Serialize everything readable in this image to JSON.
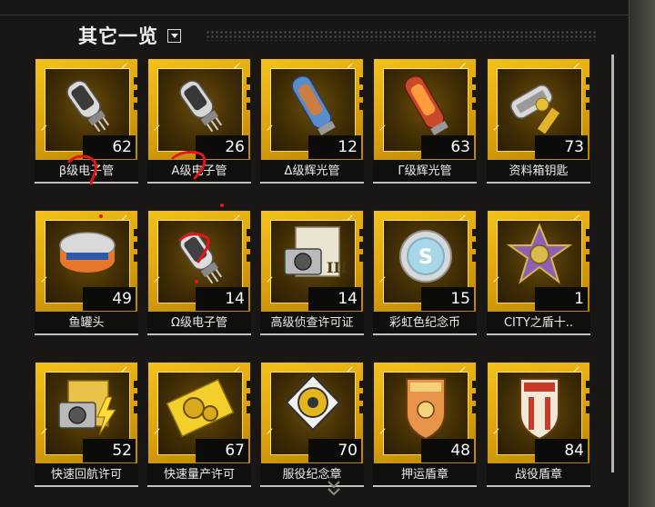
{
  "panel": {
    "title": "其它一览",
    "toggle_icon": "dropdown-toggle-icon"
  },
  "items": [
    {
      "label": "β级电子管",
      "count": "62",
      "icon": "vacuum-tube-icon"
    },
    {
      "label": "A级电子管",
      "count": "26",
      "icon": "vacuum-tube-icon"
    },
    {
      "label": "Δ级辉光管",
      "count": "12",
      "icon": "glow-tube-blue-icon"
    },
    {
      "label": "Γ级辉光管",
      "count": "63",
      "icon": "glow-tube-orange-icon"
    },
    {
      "label": "资料箱钥匙",
      "count": "73",
      "icon": "key-tag-icon"
    },
    {
      "label": "鱼罐头",
      "count": "49",
      "icon": "fish-can-icon"
    },
    {
      "label": "Ω级电子管",
      "count": "14",
      "icon": "vacuum-tube-icon"
    },
    {
      "label": "高级侦查许可证",
      "count": "14",
      "icon": "camera-ticket-icon"
    },
    {
      "label": "彩虹色纪念币",
      "count": "15",
      "icon": "rainbow-coin-icon"
    },
    {
      "label": "CITY之盾十..",
      "count": "1",
      "icon": "cross-medal-icon"
    },
    {
      "label": "快速回航许可",
      "count": "52",
      "icon": "lightning-camera-icon"
    },
    {
      "label": "快速量产许可",
      "count": "67",
      "icon": "gear-ticket-icon"
    },
    {
      "label": "服役纪念章",
      "count": "70",
      "icon": "gear-badge-icon"
    },
    {
      "label": "押运盾章",
      "count": "48",
      "icon": "shield-badge-icon"
    },
    {
      "label": "战役盾章",
      "count": "84",
      "icon": "shield-badge-icon"
    }
  ],
  "colors": {
    "card_gold": "#f3c21a",
    "label_bg": "#0f0f0e",
    "panel_bg": "#181716",
    "annotation_red": "#e8141b"
  }
}
